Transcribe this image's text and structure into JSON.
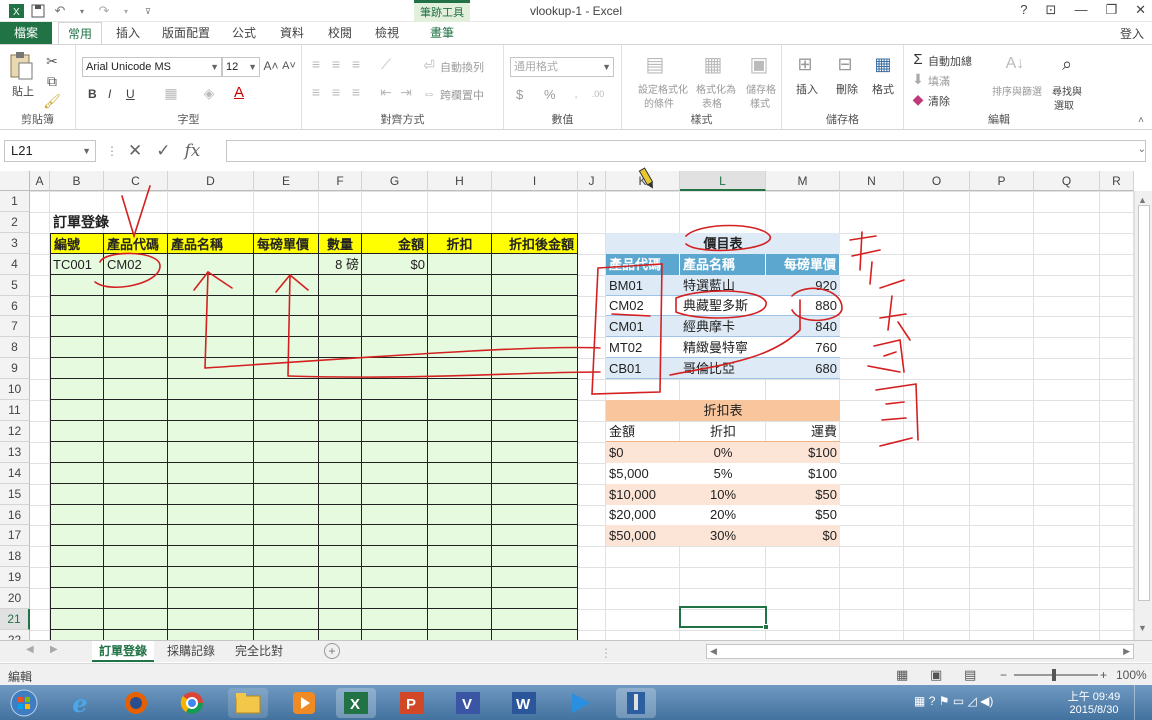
{
  "window": {
    "title": "vlookup-1 - Excel",
    "tools_group": "筆跡工具",
    "controls": [
      "?",
      "⊡",
      "—",
      "❐",
      "✕"
    ]
  },
  "tabs": [
    "檔案",
    "常用",
    "插入",
    "版面配置",
    "公式",
    "資料",
    "校閱",
    "檢視",
    "畫筆"
  ],
  "signin": "登入",
  "ribbon": {
    "clipboard": {
      "paste": "貼上",
      "label": "剪貼簿"
    },
    "font": {
      "name": "Arial Unicode MS",
      "size": "12",
      "bold": "B",
      "italic": "I",
      "underline": "U",
      "label": "字型"
    },
    "alignment": {
      "wrap": "自動換列",
      "merge": "跨欄置中",
      "label": "對齊方式"
    },
    "number": {
      "format": "通用格式",
      "currency": "$",
      "percent": "%",
      "label": "數值"
    },
    "styles": {
      "cond": [
        "設定格式化",
        "的條件"
      ],
      "table": [
        "格式化為",
        "表格"
      ],
      "cell": [
        "儲存格",
        "樣式"
      ],
      "label": "樣式"
    },
    "cells": {
      "insert": "插入",
      "delete": "刪除",
      "format": "格式",
      "label": "儲存格"
    },
    "editing": {
      "autosum": "自動加總",
      "fill": "填滿",
      "clear": "清除",
      "sort": [
        "排序與篩選"
      ],
      "find": [
        "尋找與",
        "選取"
      ],
      "label": "編輯"
    }
  },
  "formula_bar": {
    "name_box": "L21",
    "fx": "fx",
    "value": ""
  },
  "columns": [
    "A",
    "B",
    "C",
    "D",
    "E",
    "F",
    "G",
    "H",
    "I",
    "J",
    "K",
    "L",
    "M",
    "N",
    "O",
    "P",
    "Q",
    "R"
  ],
  "rows": [
    "1",
    "2",
    "3",
    "4",
    "5",
    "6",
    "7",
    "8",
    "9",
    "10",
    "11",
    "12",
    "13",
    "14",
    "15",
    "16",
    "17",
    "18",
    "19",
    "20",
    "21",
    "22"
  ],
  "order": {
    "title": "訂單登錄",
    "headers": [
      "編號",
      "產品代碼",
      "產品名稱",
      "每磅單價",
      "數量",
      "金額",
      "折扣",
      "折扣後金額"
    ],
    "row4": {
      "id": "TC001",
      "code": "CM02",
      "qty": "8 磅",
      "amount": "$0"
    }
  },
  "price_table": {
    "title": "價目表",
    "headers": [
      "產品代碼",
      "產品名稱",
      "每磅單價"
    ],
    "rows": [
      [
        "BM01",
        "特選藍山",
        "920"
      ],
      [
        "CM02",
        "典藏聖多斯",
        "880"
      ],
      [
        "CM01",
        "經典摩卡",
        "840"
      ],
      [
        "MT02",
        "精緻曼特寧",
        "760"
      ],
      [
        "CB01",
        "哥倫比亞",
        "680"
      ]
    ]
  },
  "discount_table": {
    "title": "折扣表",
    "headers": [
      "金額",
      "折扣",
      "運費"
    ],
    "rows": [
      [
        "$0",
        "0%",
        "$100"
      ],
      [
        "$5,000",
        "5%",
        "$100"
      ],
      [
        "$10,000",
        "10%",
        "$50"
      ],
      [
        "$20,000",
        "20%",
        "$50"
      ],
      [
        "$50,000",
        "30%",
        "$0"
      ]
    ]
  },
  "sheets": [
    "訂單登錄",
    "採購記錄",
    "完全比對"
  ],
  "status": {
    "mode": "編輯",
    "zoom": "100%"
  },
  "taskbar": {
    "time": "上午 09:49",
    "date": "2015/8/30"
  },
  "colors": {
    "excel_green": "#217346",
    "order_fill": "#e6fae0",
    "header_yellow": "#ffff00",
    "price_header": "#5ba7cf",
    "price_row": "#deebf7",
    "discount_header": "#f8c59c",
    "discount_row": "#fce4d6",
    "ink": "#d42020"
  }
}
